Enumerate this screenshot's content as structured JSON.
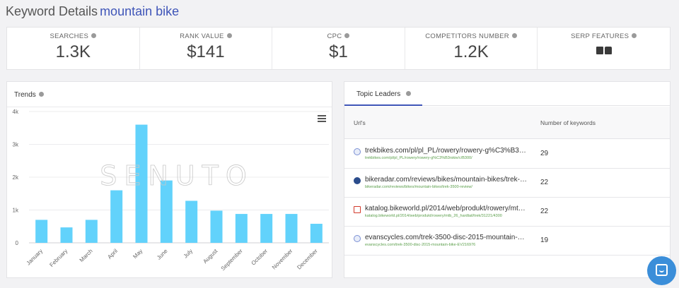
{
  "header": {
    "prefix": "Keyword Details",
    "keyword": "mountain bike"
  },
  "stats": [
    {
      "label": "SEARCHES",
      "value": "1.3K"
    },
    {
      "label": "RANK VALUE",
      "value": "$141"
    },
    {
      "label": "CPC",
      "value": "$1"
    },
    {
      "label": "COMPETITORS NUMBER",
      "value": "1.2K"
    },
    {
      "label": "SERP FEATURES",
      "icons": [
        "image-icon",
        "shopping-bag-icon"
      ]
    }
  ],
  "trends": {
    "title": "Trends",
    "watermark": "SENUTO",
    "chart_data": {
      "type": "bar",
      "categories": [
        "January",
        "February",
        "March",
        "April",
        "May",
        "June",
        "July",
        "August",
        "September",
        "October",
        "November",
        "December"
      ],
      "values": [
        700,
        470,
        700,
        1600,
        3600,
        1900,
        1280,
        980,
        880,
        880,
        880,
        580
      ],
      "ylim": [
        0,
        4000
      ],
      "yticks": [
        0,
        1000,
        2000,
        3000,
        4000
      ],
      "ytick_labels": [
        "0",
        "1k",
        "2k",
        "3k",
        "4k"
      ],
      "bar_color": "#62d2fb",
      "grid": true
    }
  },
  "leaders": {
    "tab": "Topic Leaders",
    "columns": {
      "url": "Url's",
      "keywords": "Number of keywords"
    },
    "rows": [
      {
        "url": "trekbikes.com/pl/pl_PL/rowery/rowery-g%C3%B3rskie/c/B300/",
        "sub": "trekbikes.com/pl/pl_PL/rowery/rowery-g%C3%B3rskie/c/B300/",
        "count": "29",
        "icon": "globe-icon",
        "color": "#7a8fd4"
      },
      {
        "url": "bikeradar.com/reviews/bikes/mountain-bikes/trek-3500-review/",
        "sub": "bikeradar.com/reviews/bikes/mountain-bikes/trek-3500-review/",
        "count": "22",
        "icon": "bikeradar-favicon-icon",
        "color": "#2b4c8c"
      },
      {
        "url": "katalog.bikeworld.pl/2014/web/produkt/rowery/mtb_26_hardtail/trek/31221/4300",
        "sub": "katalog.bikeworld.pl/2014/web/produkt/rowery/mtb_26_hardtail/trek/31221/4300",
        "count": "22",
        "icon": "bikeworld-favicon-icon",
        "color": "#d33a2c"
      },
      {
        "url": "evanscycles.com/trek-3500-disc-2015-mountain-bike-EV216976",
        "sub": "evanscycles.com/trek-3500-disc-2015-mountain-bike-EV216976",
        "count": "19",
        "icon": "globe-icon",
        "color": "#7a8fd4"
      }
    ]
  }
}
